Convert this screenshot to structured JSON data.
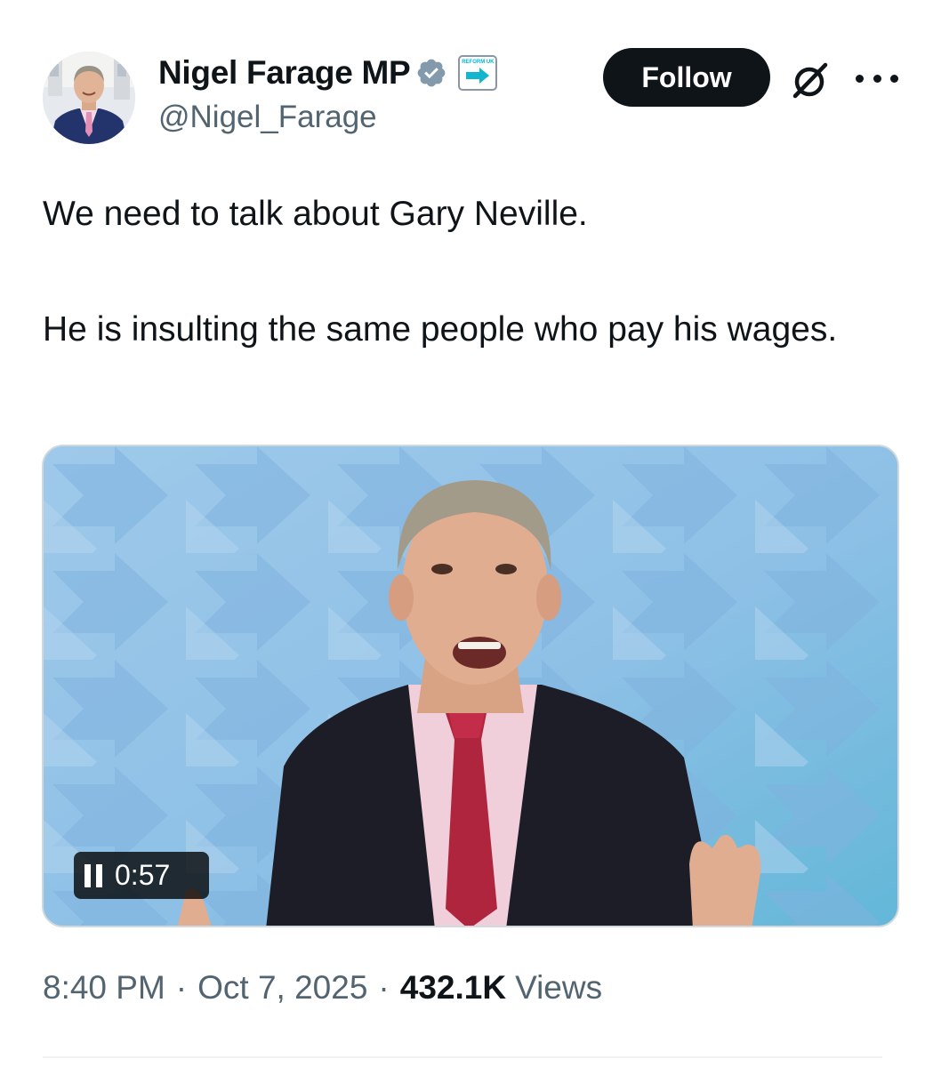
{
  "author": {
    "display_name": "Nigel Farage MP",
    "handle": "@Nigel_Farage",
    "verified": true,
    "affiliate_badge_text": "REFORM UK",
    "avatar_icon": "profile-photo"
  },
  "actions": {
    "follow_label": "Follow",
    "grok_icon": "grok-icon",
    "more_icon": "more-icon"
  },
  "tweet": {
    "paragraphs": [
      "We need to talk about Gary Neville.",
      "He is insulting the same people who pay his wages."
    ]
  },
  "media": {
    "type": "video",
    "time_remaining": "0:57",
    "playing": true
  },
  "meta": {
    "time": "8:40 PM",
    "date": "Oct 7, 2025",
    "views_count": "432.1K",
    "views_label": "Views"
  },
  "colors": {
    "accent": "#1d9bf0",
    "text": "#0f1419",
    "secondary": "#536471",
    "follow_bg": "#0f1419"
  }
}
